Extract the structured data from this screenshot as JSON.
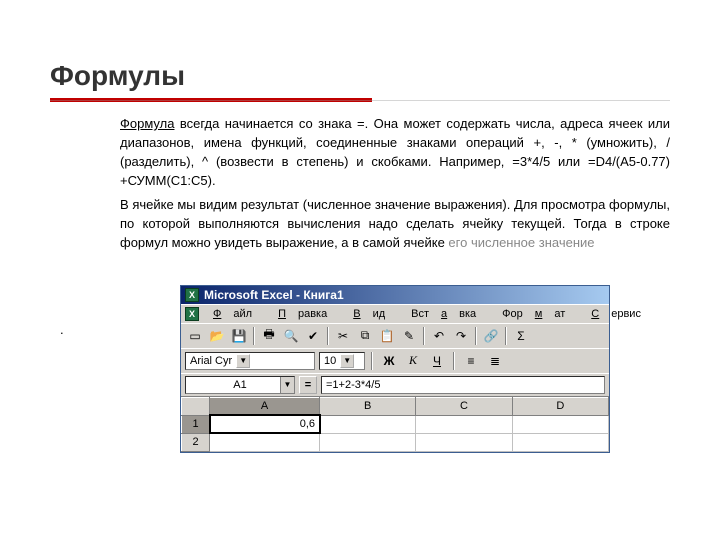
{
  "title": "Формулы",
  "para1_lead": "Формула",
  "para1_rest": " всегда начинается со знака =. Она может содержать числа, адреса ячеек или диапазонов, имена функций, соединенные знаками операций +, -, * (умножить), / (разделить), ^ (возвести в степень) и скобками. Например, =3*4/5 или =D4/(A5-0.77) +СУММ(C1:C5).",
  "para2_main": "В ячейке мы видим результат (численное значение выражения). Для просмотра формулы, по которой выполняются вычисления надо сделать ячейку текущей. Тогда в строке формул можно увидеть выражение, а в самой ячейке ",
  "para2_tail": "его численное значение",
  "dot": ".",
  "excel": {
    "titlebar": "Microsoft Excel - Книга1",
    "menu": {
      "file": {
        "m": "Ф",
        "rest": "айл"
      },
      "edit": {
        "m": "П",
        "rest": "равка"
      },
      "view": {
        "m": "В",
        "rest": "ид"
      },
      "insert": {
        "pre": "Вст",
        "m": "а",
        "rest": "вка"
      },
      "format": {
        "pre": "Фор",
        "m": "м",
        "rest": "ат"
      },
      "tools": {
        "m": "С",
        "rest": "ервис"
      }
    },
    "font_name": "Arial Cyr",
    "font_size": "10",
    "bold": "Ж",
    "italic": "К",
    "under": "Ч",
    "namebox": "A1",
    "formula": "=1+2-3*4/5",
    "columns": [
      "A",
      "B",
      "C",
      "D"
    ],
    "rows": [
      "1",
      "2"
    ],
    "a1_value": "0,6"
  },
  "icons": {
    "sigma": "Σ",
    "new": "▭",
    "open": "📂",
    "save": "💾",
    "print": "🖶",
    "preview": "🔍",
    "spell": "✔",
    "cut": "✂",
    "copy": "⧉",
    "paste": "📋",
    "brush": "✎",
    "undo": "↶",
    "redo": "↷",
    "link": "🔗",
    "align_l": "≡",
    "align_c": "≣"
  }
}
